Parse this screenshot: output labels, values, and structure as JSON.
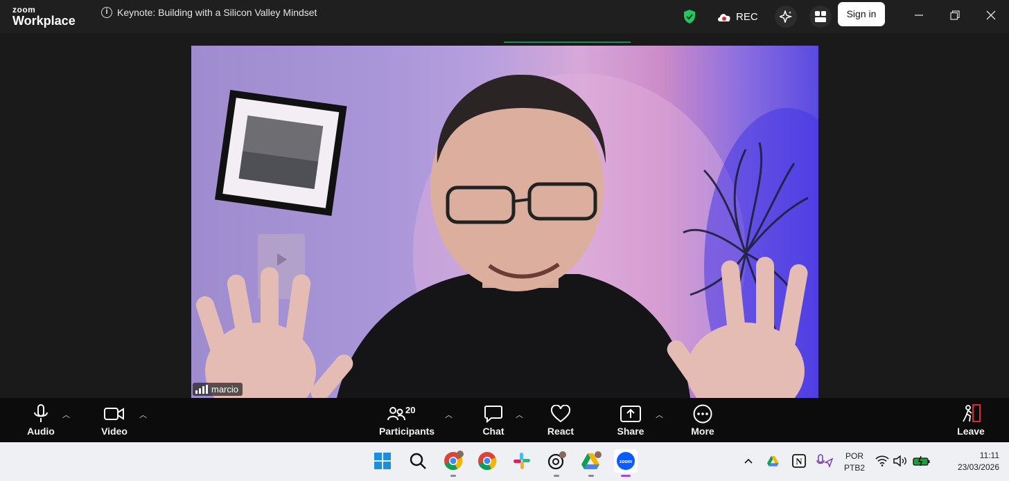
{
  "app": {
    "logo_top": "zoom",
    "logo_bottom": "Workplace",
    "meeting_title": "Keynote: Building with a Silicon Valley Mindset",
    "rec_label": "REC",
    "signin_label": "Sign in"
  },
  "video": {
    "participant_name": "marcio"
  },
  "toolbar": {
    "audio_label": "Audio",
    "video_label": "Video",
    "participants_label": "Participants",
    "participants_count": "20",
    "chat_label": "Chat",
    "react_label": "React",
    "share_label": "Share",
    "more_label": "More",
    "leave_label": "Leave"
  },
  "taskbar": {
    "lang_top": "POR",
    "lang_bottom": "PTB2",
    "time": "11:11",
    "date": "23/03/2026"
  },
  "colors": {
    "brand_zoom": "#0b5cff",
    "shield_green": "#22c55e",
    "leave_red": "#e0282e"
  }
}
